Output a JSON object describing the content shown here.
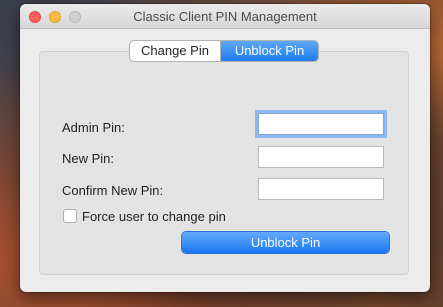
{
  "window": {
    "title": "Classic Client PIN Management"
  },
  "tabs": [
    {
      "label": "Change Pin",
      "active": false
    },
    {
      "label": "Unblock Pin",
      "active": true
    }
  ],
  "form": {
    "admin_pin": {
      "label": "Admin Pin:",
      "value": ""
    },
    "new_pin": {
      "label": "New Pin:",
      "value": ""
    },
    "confirm_pin": {
      "label": "Confirm New Pin:",
      "value": ""
    },
    "force_change": {
      "label": "Force user to change pin",
      "checked": false
    },
    "submit_label": "Unblock Pin"
  },
  "colors": {
    "accent": "#1d7cf2",
    "close": "#fc605c",
    "minimize": "#fdbc40"
  }
}
